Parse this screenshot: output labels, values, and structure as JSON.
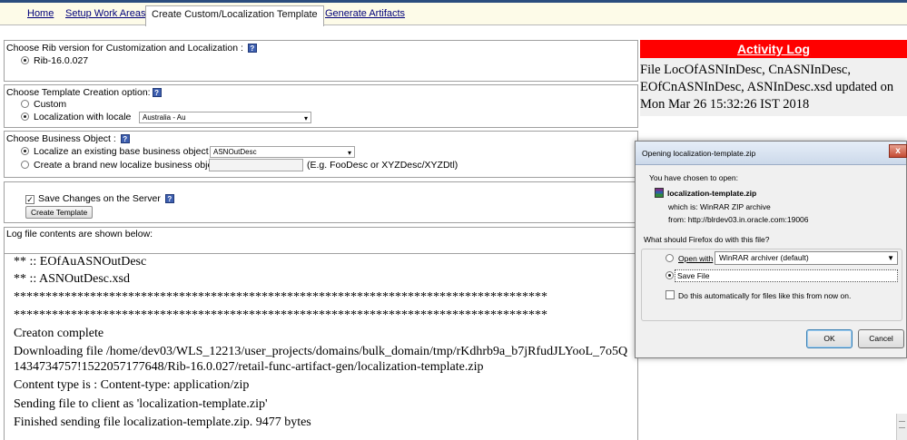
{
  "nav": {
    "tabs": [
      "Home",
      "Setup Work Areas",
      "Create Custom/Localization Template",
      "Generate Artifacts"
    ]
  },
  "rib": {
    "title": "Choose Rib version for Customization and Localization :",
    "option": "Rib-16.0.027"
  },
  "template": {
    "title": "Choose Template Creation option:",
    "custom": "Custom",
    "localization": "Localization with locale",
    "locale_value": "Australia - Au"
  },
  "business": {
    "title": "Choose Business Object :",
    "existing_label": "Localize an existing base business object :",
    "existing_value": "ASNOutDesc",
    "new_label": "Create a brand new localize business object :",
    "new_hint": "(E.g. FooDesc or XYZDesc/XYZDtl)"
  },
  "save": {
    "checkbox_label": "Save Changes on the Server",
    "button": "Create Template"
  },
  "log": {
    "title": "Log file contents are shown below:",
    "lines": [
      "** :: EOfAuASNOutDesc",
      "** :: ASNOutDesc.xsd",
      "************************************************************************************",
      "************************************************************************************",
      "Creaton complete",
      "Downloading file /home/dev03/WLS_12213/user_projects/domains/bulk_domain/tmp/rKdhrb9a_b7jRfudJLYooL_7o5Q",
      "1434734757!1522057177648/Rib-16.0.027/retail-func-artifact-gen/localization-template.zip",
      "Content type is : Content-type: application/zip",
      "Sending file to client as 'localization-template.zip'",
      "Finished sending file localization-template.zip. 9477 bytes"
    ]
  },
  "activity": {
    "title": "Activity Log",
    "message": "File LocOfASNInDesc, CnASNInDesc, EOfCnASNInDesc, ASNInDesc.xsd updated on Mon Mar 26 15:32:26 IST 2018"
  },
  "dialog": {
    "title": "Opening localization-template.zip",
    "chosen": "You have chosen to open:",
    "filename": "localization-template.zip",
    "which_is": "which is: WinRAR ZIP archive",
    "from": "from: http://blrdev03.in.oracle.com:19006",
    "question": "What should Firefox do with this file?",
    "open_with": "Open with",
    "open_with_app": "WinRAR archiver (default)",
    "save_file": "Save File",
    "auto_label": "Do this automatically for files like this from now on.",
    "ok": "OK",
    "cancel": "Cancel"
  }
}
